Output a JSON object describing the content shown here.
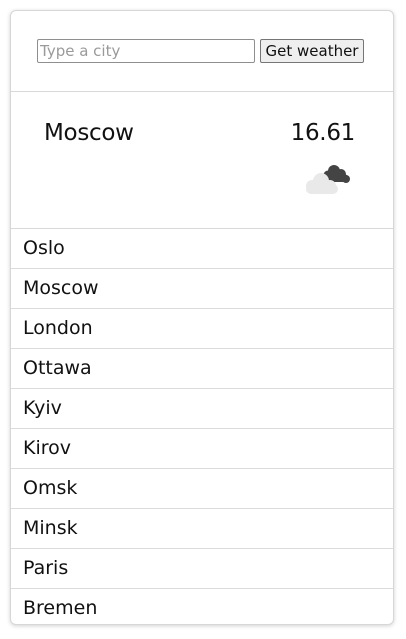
{
  "search": {
    "placeholder": "Type a city",
    "value": "",
    "button_label": "Get weather"
  },
  "current": {
    "city": "Moscow",
    "temperature": "16.61",
    "icon": "cloudy-icon"
  },
  "cities": [
    "Oslo",
    "Moscow",
    "London",
    "Ottawa",
    "Kyiv",
    "Kirov",
    "Omsk",
    "Minsk",
    "Paris",
    "Bremen"
  ]
}
